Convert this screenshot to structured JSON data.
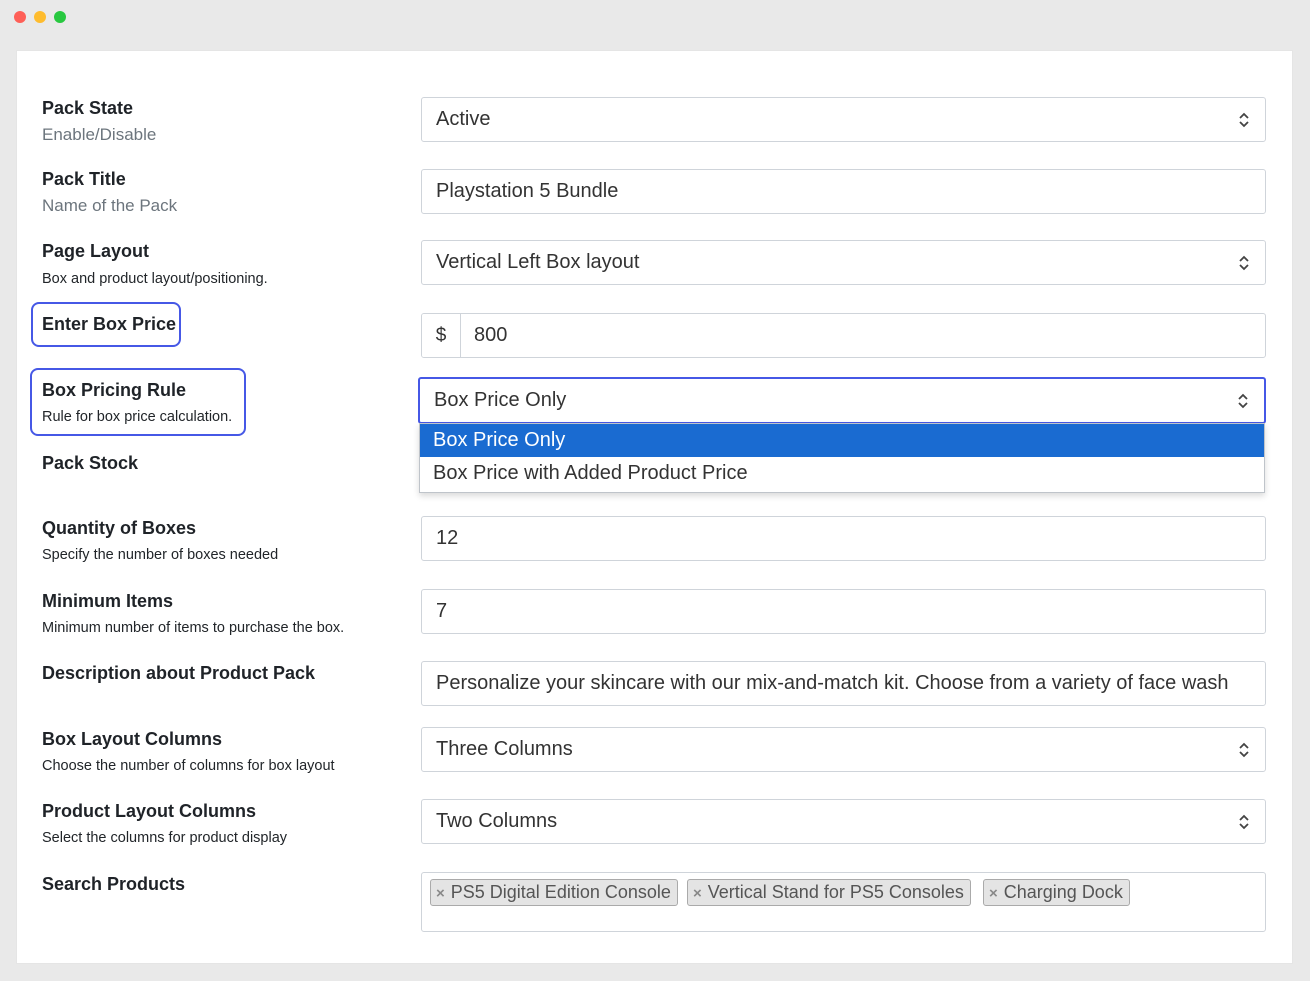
{
  "form": {
    "pack_state": {
      "title": "Pack State",
      "subtitle": "Enable/Disable",
      "value": "Active"
    },
    "pack_title": {
      "title": "Pack Title",
      "subtitle": "Name of the Pack",
      "value": "Playstation 5 Bundle"
    },
    "page_layout": {
      "title": "Page Layout",
      "subtitle": "Box and product layout/positioning.",
      "value": "Vertical Left Box layout"
    },
    "box_price": {
      "title": "Enter Box Price",
      "currency": "$",
      "value": "800"
    },
    "pricing_rule": {
      "title": "Box Pricing Rule",
      "subtitle": "Rule for box price calculation.",
      "value": "Box Price Only",
      "options": [
        "Box Price Only",
        "Box Price with Added Product Price"
      ]
    },
    "pack_stock": {
      "title": "Pack Stock"
    },
    "quantity_boxes": {
      "title": "Quantity of Boxes",
      "subtitle": "Specify the number of boxes needed",
      "value": "12"
    },
    "minimum_items": {
      "title": "Minimum Items",
      "subtitle": "Minimum number of items to purchase the box.",
      "value": "7"
    },
    "description": {
      "title": "Description about Product Pack",
      "value": "Personalize your skincare with our mix-and-match kit. Choose from a variety of face wash"
    },
    "box_layout_columns": {
      "title": "Box Layout Columns",
      "subtitle": "Choose the number of columns for box layout",
      "value": "Three Columns"
    },
    "product_layout_columns": {
      "title": "Product Layout Columns",
      "subtitle": "Select the columns for product display",
      "value": "Two Columns"
    },
    "search_products": {
      "title": "Search Products",
      "tags": [
        "PS5 Digital Edition Console",
        "Vertical Stand for PS5 Consoles",
        "Charging Dock"
      ],
      "remove_symbol": "×"
    }
  },
  "colors": {
    "highlight": "#4658e6",
    "selected_option": "#1a6bd1",
    "window_red": "#fe5f57",
    "window_yellow": "#febc2e",
    "window_green": "#28c840"
  }
}
